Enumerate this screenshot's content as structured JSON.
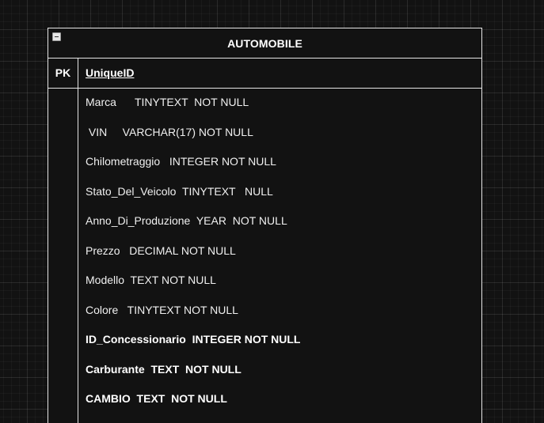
{
  "entity": {
    "title": "AUTOMOBILE",
    "pk_label": "PK",
    "pk_field": "UniqueID",
    "fields": [
      {
        "text": "Marca      TINYTEXT  NOT NULL",
        "bold": false
      },
      {
        "text": " VIN     VARCHAR(17) NOT NULL",
        "bold": false
      },
      {
        "text": "Chilometraggio   INTEGER NOT NULL",
        "bold": false
      },
      {
        "text": "Stato_Del_Veicolo  TINYTEXT   NULL",
        "bold": false
      },
      {
        "text": "Anno_Di_Produzione  YEAR  NOT NULL",
        "bold": false
      },
      {
        "text": "Prezzo   DECIMAL NOT NULL",
        "bold": false
      },
      {
        "text": "Modello  TEXT NOT NULL",
        "bold": false
      },
      {
        "text": "Colore   TINYTEXT NOT NULL",
        "bold": false
      },
      {
        "text": "ID_Concessionario  INTEGER NOT NULL",
        "bold": true
      },
      {
        "text": "Carburante  TEXT  NOT NULL",
        "bold": true
      },
      {
        "text": "CAMBIO  TEXT  NOT NULL",
        "bold": true
      }
    ]
  }
}
